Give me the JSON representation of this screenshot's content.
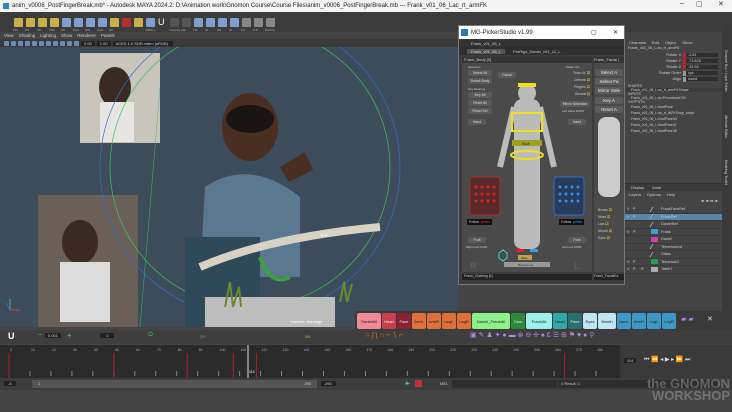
{
  "window": {
    "title": "anim_v0006_PostFingerBreak.mb* - Autodesk MAYA 2024.2: D:\\Animation work\\Gnomon Course\\Course Files\\anim_v0006_PostFingerBreak.mb --- Frank_v01_06_Lac_rt_armFK",
    "min": "–",
    "max": "▢",
    "close": "✕"
  },
  "shelf": [
    "MG",
    "DS",
    "SS",
    "SSA",
    "HK",
    "Dust",
    "NW",
    "Hvar",
    "CP",
    "",
    "",
    "IWBany",
    "U",
    "Invsolve",
    "p3k",
    "TR",
    "SL",
    "RS",
    "CL",
    "2.0",
    "S.B",
    "BunRig"
  ],
  "viewport": {
    "menu": [
      "View",
      "Shading",
      "Lighting",
      "Show",
      "Renderer",
      "Panels"
    ],
    "toolbar": {
      "val1": "0.00",
      "val2": "1.00",
      "colorspace": "ACES 1.0 SDR-video (sRGB)"
    },
    "camera_label": "Camera: Sausage"
  },
  "picker": {
    "title": "MG-PickerStudio v1.99",
    "character": "Frank_v01_06_L",
    "tabs": [
      "Frank_v01_06_L",
      "ProRigs_Daniel_v01_12_L"
    ],
    "body_panel": "Frank_Body [0]",
    "facial_panel": "Frank_Facial [",
    "selection_label": "Selection",
    "select_all": "Select All",
    "select_body": "Select Body",
    "key_label": "Key Running",
    "key_all": "Key All",
    "reset_all": "Reset All",
    "reset_sel": "Reset Sel",
    "facial_btn": "Facial",
    "picker_vis": "Picker Vis",
    "vis_items": [
      "Torso IK",
      "Deform",
      "Fingers",
      "Gimbal"
    ],
    "mirror": "Mirror Selection",
    "left_hand": "Left Hand DOPA",
    "hand_r": "Hand",
    "hand_l": "Hand",
    "root": "Root",
    "follow_r": "Follow",
    "follow_r_val": "pelvis",
    "follow_l": "Follow",
    "follow_l_val": "pelvis",
    "foot_r": "Foot",
    "foot_l": "Foot",
    "right_foot": "Right Foot DOPA",
    "left_foot": "Left Foot DOPA",
    "base": "Base",
    "baseforest": "BaseForest",
    "R": "R",
    "L": "L",
    "clothing": "Frank_Clothing [4]",
    "facial2": "Frank_FacialEx",
    "face_vis": [
      "Brows",
      "Nose",
      "Lips",
      "Mouth",
      "Eyes"
    ],
    "facial_buttons": [
      "Select A",
      "Select Fa",
      "Mirror Sele",
      "Key A",
      "Reset A"
    ]
  },
  "channels": {
    "menu": [
      "Channels",
      "Edit",
      "Object",
      "Show"
    ],
    "node": "Frank_v01_06_L:ac_rt_armFK",
    "attrs": [
      {
        "name": "Rotate X",
        "value": "-2.81"
      },
      {
        "name": "Rotate Y",
        "value": "-73.828"
      },
      {
        "name": "Rotate Z",
        "value": "-34.66"
      },
      {
        "name": "Rotate Order",
        "value": "xyz"
      },
      {
        "name": "Align",
        "value": "world"
      }
    ],
    "shapes_label": "SHAPES",
    "shape": "Frank_v01_06_L:ac_rt_armFKShape",
    "inputs_label": "INPUTS",
    "input": "Frank_v01_06_L:ac:Procedural?20",
    "outputs_label": "OUTPUTS",
    "outputs": [
      "Frank_v01_06_L:bindPose",
      "Frank_v01_06_L:ac_rt_IKFKSnap_script",
      "Frank_v01_06_L:bindPose44",
      "Frank_v01_06_L:bindPose47",
      "Frank_v01_06_L:bindPose48"
    ]
  },
  "layers": {
    "tabs": [
      "Display",
      "Anim"
    ],
    "menu": [
      "Layers",
      "Options",
      "Help"
    ],
    "items": [
      {
        "v": "V",
        "p": "P",
        "r": "",
        "name": "FrankFaceRef",
        "color": "",
        "selected": false
      },
      {
        "v": "V",
        "p": "P",
        "r": "",
        "name": "FrankRef",
        "color": "",
        "selected": true
      },
      {
        "v": "",
        "p": "",
        "r": "",
        "name": "DanielRef",
        "color": "",
        "selected": false
      },
      {
        "v": "V",
        "p": "P",
        "r": "",
        "name": "Frank",
        "color": "#3aa0d8",
        "selected": false
      },
      {
        "v": "",
        "p": "",
        "r": "",
        "name": "Daniel",
        "color": "#d040b0",
        "selected": false
      },
      {
        "v": "",
        "p": "",
        "r": "",
        "name": "TerrariumLid",
        "color": "",
        "selected": false
      },
      {
        "v": "",
        "p": "",
        "r": "",
        "name": "Glass",
        "color": "",
        "selected": false
      },
      {
        "v": "V",
        "p": "P",
        "r": "",
        "name": "Terrarium1",
        "color": "#20a050",
        "selected": false
      },
      {
        "v": "V",
        "p": "P",
        "r": "R",
        "name": "Table1",
        "color": "#aaaaaa",
        "selected": false
      }
    ]
  },
  "side_tabs": [
    "Channel Box / Layer Editor",
    "Attribute Editor",
    "Modeling Toolkit"
  ],
  "sets": [
    {
      "label": "DanielAll",
      "color": "#f08a96"
    },
    {
      "label": "Head",
      "color": "#c8404e"
    },
    {
      "label": "Face",
      "color": "#8a2030"
    },
    {
      "label": "ArmL",
      "color": "#e0703a"
    },
    {
      "label": "ArmR",
      "color": "#e0703a"
    },
    {
      "label": "LegL",
      "color": "#e0703a"
    },
    {
      "label": "LegR",
      "color": "#e0703a"
    },
    {
      "label": "Daniel_FrankAll",
      "color": "#8ef08a"
    },
    {
      "label": "Cam",
      "color": "#2e8a3a"
    },
    {
      "label": "FrankAll",
      "color": "#9ef0ec"
    },
    {
      "label": "Head",
      "color": "#30a8a8"
    },
    {
      "label": "Face",
      "color": "#2a7070"
    },
    {
      "label": "Eyes",
      "color": "#bfe6f2"
    },
    {
      "label": "Mouth",
      "color": "#bfe6f2"
    },
    {
      "label": "ArmL",
      "color": "#3c98c8"
    },
    {
      "label": "ArmR",
      "color": "#3c98c8"
    },
    {
      "label": "LegL",
      "color": "#3c98c8"
    },
    {
      "label": "LegR",
      "color": "#3c98c8"
    }
  ],
  "tween": {
    "value": "0.001",
    "step": "1",
    "label1": "DH",
    "label2": "BN"
  },
  "timeline": {
    "ticks": [
      "0",
      "10",
      "20",
      "30",
      "40",
      "50",
      "60",
      "70",
      "80",
      "90",
      "100",
      "110",
      "120",
      "130",
      "140",
      "150",
      "160",
      "170",
      "180",
      "190",
      "200",
      "210",
      "220",
      "230",
      "240",
      "250",
      "260",
      "270",
      "280"
    ],
    "current": "114",
    "current_field": "114"
  },
  "range": {
    "start_outer": "-4",
    "start": "1",
    "end": "290",
    "end_outer": "290"
  },
  "bottom": {
    "mel_label": "MEL",
    "result": "// Result: 1"
  },
  "watermark": "the GNOMON WORKSHOP"
}
